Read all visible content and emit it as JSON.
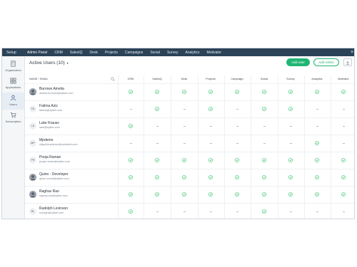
{
  "topbar": {
    "setup": "Setup",
    "nav": [
      "Admin Panel",
      "CRM",
      "SalesIQ",
      "Desk",
      "Projects",
      "Campaigns",
      "Social",
      "Survey",
      "Analytics",
      "Motivator"
    ],
    "close": "×"
  },
  "sidebar": {
    "items": [
      {
        "label": "Organization",
        "icon": "building-icon"
      },
      {
        "label": "Applications",
        "icon": "grid-icon"
      },
      {
        "label": "Users",
        "icon": "user-icon"
      },
      {
        "label": "Subscription",
        "icon": "cart-icon"
      }
    ],
    "active": "Users"
  },
  "header": {
    "title": "Active Users (10)",
    "caret": "▾",
    "add_user": "Add User",
    "add_admin": "Add Admin"
  },
  "table": {
    "name_header": "NAME / EMAIL",
    "columns": [
      "CRM",
      "SalesIQ",
      "Desk",
      "Projects",
      "Campaign",
      "Social",
      "Survey",
      "Analytics",
      "Motivator"
    ],
    "rows": [
      {
        "name": "Burrows Amelia",
        "email": "amelia.burrows@zylker.com",
        "avatar": "photo",
        "access": [
          1,
          1,
          1,
          1,
          1,
          1,
          1,
          1,
          1
        ]
      },
      {
        "name": "Fatima Aziz",
        "email": "fatima@zylker.com",
        "avatar": "FA",
        "access": [
          0,
          1,
          0,
          1,
          0,
          1,
          1,
          0,
          0
        ]
      },
      {
        "name": "Luke Krauss",
        "email": "luke@zylker.com",
        "avatar": "LK",
        "access": [
          1,
          0,
          0,
          0,
          0,
          0,
          0,
          0,
          0
        ]
      },
      {
        "name": "Mpdemo",
        "email": "vijay.krimpdemo@zohotest.com",
        "avatar": "MP",
        "access": [
          0,
          0,
          0,
          0,
          0,
          0,
          0,
          1,
          0
        ]
      },
      {
        "name": "Pooja Raman",
        "email": "pooja.raman@zylker.com",
        "avatar": "PR",
        "access": [
          1,
          1,
          1,
          1,
          1,
          1,
          1,
          1,
          1
        ]
      },
      {
        "name": "Quinn - Developer",
        "email": "quinn.creed@zylker.com",
        "avatar": "photo",
        "access": [
          1,
          1,
          1,
          1,
          1,
          1,
          1,
          1,
          1
        ]
      },
      {
        "name": "Raghav Rao",
        "email": "raghav.rao@zylker.com",
        "avatar": "photo",
        "access": [
          1,
          1,
          1,
          1,
          1,
          1,
          1,
          1,
          1
        ]
      },
      {
        "name": "Rudolph Levinson",
        "email": "rudolph@zylker.com",
        "avatar": "RL",
        "access": [
          1,
          0,
          0,
          0,
          0,
          1,
          0,
          0,
          0
        ]
      }
    ]
  },
  "colors": {
    "topbar": "#2b4257",
    "accent_green": "#21b573",
    "check_green": "#2fbf6d"
  }
}
